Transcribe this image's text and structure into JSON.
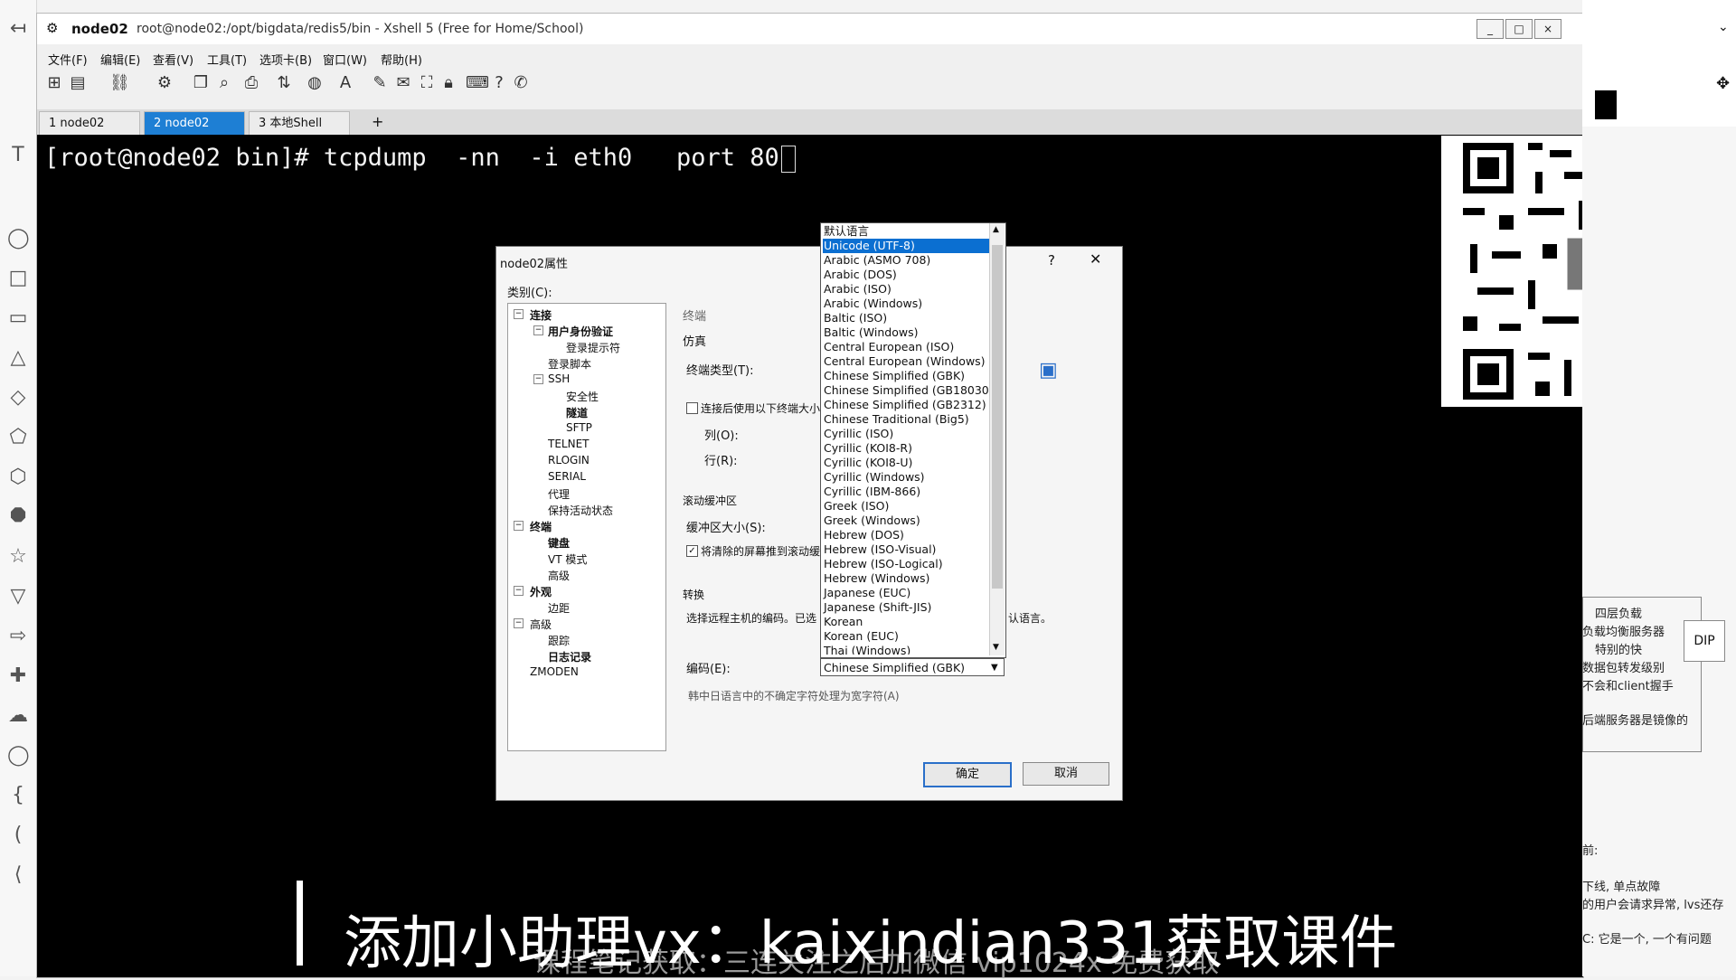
{
  "window": {
    "app_name": "node02",
    "title_path": "root@node02:/opt/bigdata/redis5/bin - Xshell 5 (Free for Home/School)",
    "controls": [
      "_",
      "□",
      "×"
    ]
  },
  "menu": [
    "文件(F)",
    "编辑(E)",
    "查看(V)",
    "工具(T)",
    "选项卡(B)",
    "窗口(W)",
    "帮助(H)"
  ],
  "tabs": [
    {
      "label": "1 node02"
    },
    {
      "label": "2 node02"
    },
    {
      "label": "3 本地Shell"
    }
  ],
  "tab_add": "+",
  "terminal": {
    "line": "[root@node02 bin]# tcpdump  -nn  -i eth0   port 80"
  },
  "dialog": {
    "title": "node02属性",
    "help": "?",
    "close": "✕",
    "category_label": "类别(C):",
    "tree": [
      {
        "label": "连接",
        "bold": true,
        "toggle": "−"
      },
      {
        "label": "用户身份验证",
        "bold": true,
        "toggle": "−"
      },
      {
        "label": "登录提示符",
        "bold": false
      },
      {
        "label": "登录脚本",
        "bold": false
      },
      {
        "label": "SSH",
        "bold": false,
        "toggle": "−"
      },
      {
        "label": "安全性",
        "bold": false
      },
      {
        "label": "隧道",
        "bold": true
      },
      {
        "label": "SFTP",
        "bold": false
      },
      {
        "label": "TELNET",
        "bold": false
      },
      {
        "label": "RLOGIN",
        "bold": false
      },
      {
        "label": "SERIAL",
        "bold": false
      },
      {
        "label": "代理",
        "bold": false
      },
      {
        "label": "保持活动状态",
        "bold": false
      },
      {
        "label": "终端",
        "bold": true,
        "toggle": "−"
      },
      {
        "label": "键盘",
        "bold": true
      },
      {
        "label": "VT 模式",
        "bold": false
      },
      {
        "label": "高级",
        "bold": false
      },
      {
        "label": "外观",
        "bold": true,
        "toggle": "−"
      },
      {
        "label": "边距",
        "bold": false
      },
      {
        "label": "高级",
        "bold": false,
        "toggle": "−"
      },
      {
        "label": "跟踪",
        "bold": false
      },
      {
        "label": "日志记录",
        "bold": true
      },
      {
        "label": "ZMODEN",
        "bold": false
      }
    ],
    "section_terminal": "终端",
    "emulation": "仿真",
    "terminal_type": "终端类型(T):",
    "resize_check": "连接后使用以下终端大小",
    "cols": "列(O):",
    "rows": "行(R):",
    "scroll_buffer": "滚动缓冲区",
    "buffer_size": "缓冲区大小(S):",
    "push_screen": "将清除的屏幕推到滚动缓冲区",
    "conversion": "转换",
    "encoding_desc": "选择远程主机的编码。已选",
    "encoding_desc_tail": "认语言。",
    "encoding_label": "编码(E):",
    "cjk_option": "韩中日语言中的不确定字符处理为宽字符(A)",
    "ok": "确定",
    "cancel": "取消"
  },
  "encoding_list": {
    "header": "默认语言",
    "selected_value": "Chinese Simplified (GBK)",
    "items": [
      "Unicode (UTF-8)",
      "Arabic (ASMO 708)",
      "Arabic (DOS)",
      "Arabic (ISO)",
      "Arabic (Windows)",
      "Baltic (ISO)",
      "Baltic (Windows)",
      "Central European (ISO)",
      "Central European (Windows)",
      "Chinese Simplified (GBK)",
      "Chinese Simplified (GB18030)",
      "Chinese Simplified (GB2312)",
      "Chinese Traditional (Big5)",
      "Cyrillic (ISO)",
      "Cyrillic (KOI8-R)",
      "Cyrillic (KOI8-U)",
      "Cyrillic (Windows)",
      "Cyrillic (IBM-866)",
      "Greek (ISO)",
      "Greek (Windows)",
      "Hebrew (DOS)",
      "Hebrew (ISO-Visual)",
      "Hebrew (ISO-Logical)",
      "Hebrew (Windows)",
      "Japanese (EUC)",
      "Japanese (Shift-JIS)",
      "Korean",
      "Korean (EUC)",
      "Thai (Windows)"
    ]
  },
  "right_panel": {
    "notes": [
      "四层负载",
      "负载均衡服务器",
      "特别的快",
      "数据包转发级别",
      "不会和client握手",
      "后端服务器是镜像的",
      "前:",
      "下线, 单点故障",
      "的用户会请求异常, lvs还存",
      "C: 它是一个, 一个有问题"
    ],
    "dip": "DIP"
  },
  "overlay": {
    "caption": "添加小助理vx：kaixindian331获取课件",
    "subcaption": "课程笔记获取：三连关注之后加微信 vip1024x 免费获取"
  },
  "colors": {
    "terminal_bg": "#000000",
    "tab_active": "#1e7fd4",
    "selection": "#0b6fd1"
  }
}
